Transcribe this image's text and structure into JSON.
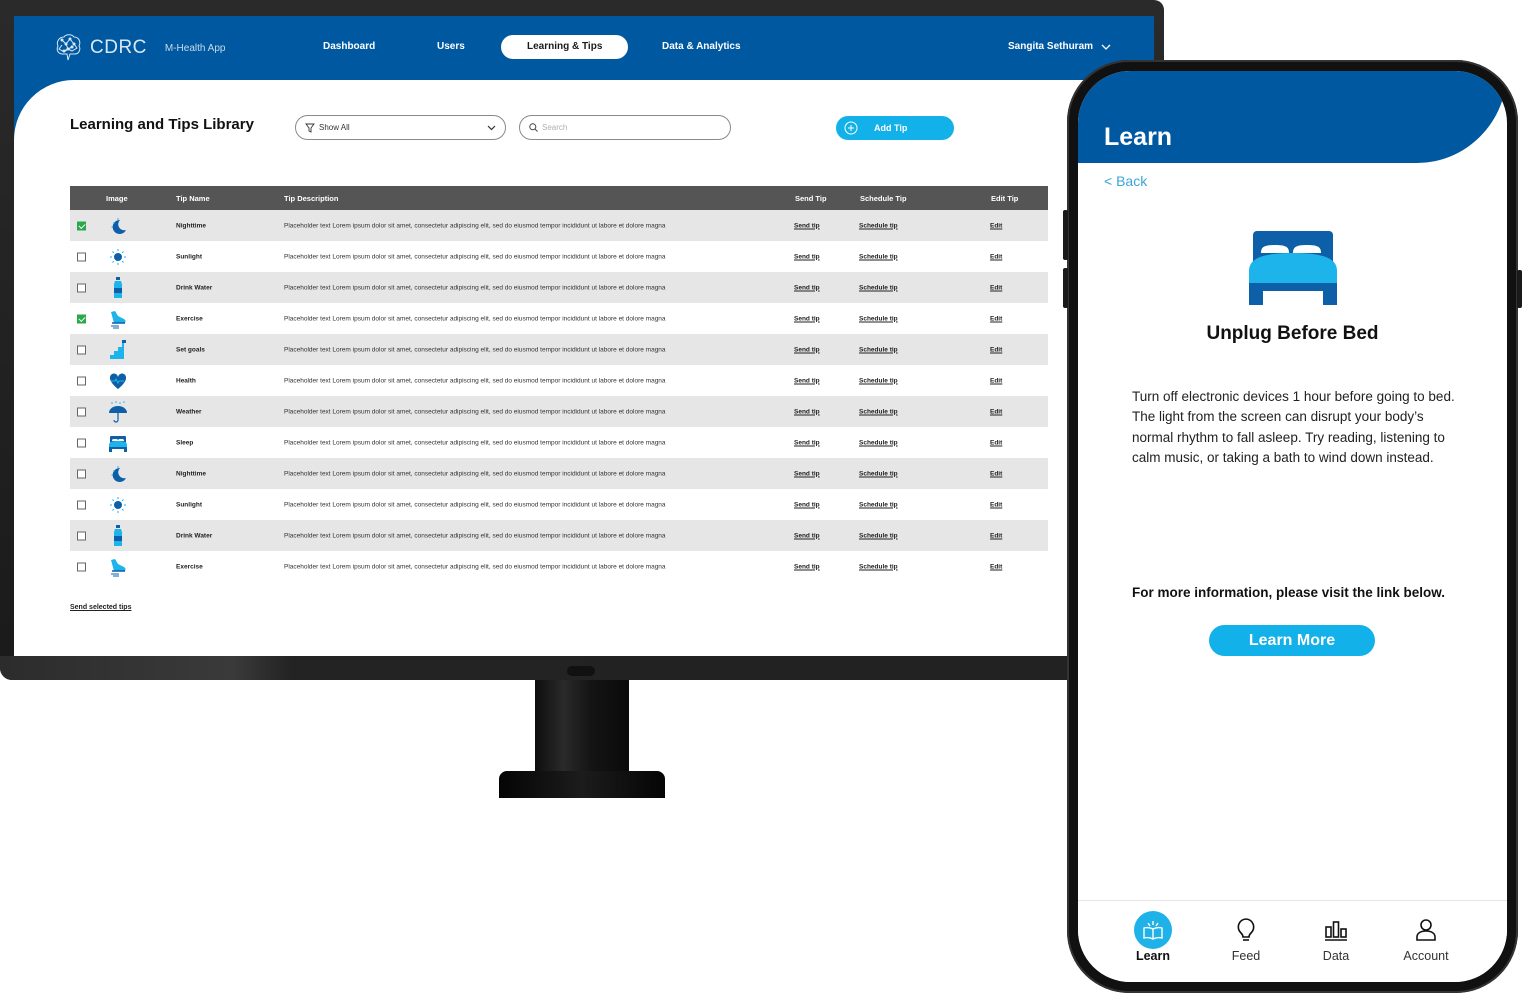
{
  "desktop": {
    "brand": {
      "name": "CDRC",
      "subtitle": "M-Health App",
      "icon": "brain-network-icon"
    },
    "nav": [
      {
        "label": "Dashboard",
        "active": false
      },
      {
        "label": "Users",
        "active": false
      },
      {
        "label": "Learning & Tips",
        "active": true
      },
      {
        "label": "Data & Analytics",
        "active": false
      }
    ],
    "user_menu": {
      "name": "Sangita Sethuram",
      "icon": "chevron-down-icon"
    },
    "page_title": "Learning and Tips Library",
    "filter": {
      "selected": "Show All",
      "icon": "filter-icon"
    },
    "search": {
      "placeholder": "Search",
      "value": ""
    },
    "add_button": {
      "label": "Add Tip",
      "icon": "plus-circle-icon"
    },
    "table": {
      "columns": [
        "",
        "Image",
        "Tip Name",
        "Tip Description",
        "Send Tip",
        "Schedule Tip",
        "Edit Tip"
      ],
      "rows": [
        {
          "checked": true,
          "icon": "moon-icon",
          "name": "Nighttime",
          "description": "Placeholder text  Lorem ipsum dolor sit amet, consectetur adipiscing elit, sed do eiusmod tempor incididunt ut labore et dolore magna",
          "send": "Send tip",
          "schedule": "Schedule tip",
          "edit": "Edit"
        },
        {
          "checked": false,
          "icon": "sun-icon",
          "name": "Sunlight",
          "description": "Placeholder text  Lorem ipsum dolor sit amet, consectetur adipiscing elit, sed do eiusmod tempor incididunt ut labore et dolore magna",
          "send": "Send tip",
          "schedule": "Schedule tip",
          "edit": "Edit"
        },
        {
          "checked": false,
          "icon": "water-bottle-icon",
          "name": "Drink Water",
          "description": "Placeholder text  Lorem ipsum dolor sit amet, consectetur adipiscing elit, sed do eiusmod tempor incididunt ut labore et dolore magna",
          "send": "Send tip",
          "schedule": "Schedule tip",
          "edit": "Edit"
        },
        {
          "checked": true,
          "icon": "sneaker-icon",
          "name": "Exercise",
          "description": "Placeholder text  Lorem ipsum dolor sit amet, consectetur adipiscing elit, sed do eiusmod tempor incididunt ut labore et dolore magna",
          "send": "Send tip",
          "schedule": "Schedule tip",
          "edit": "Edit"
        },
        {
          "checked": false,
          "icon": "stairs-flag-icon",
          "name": "Set goals",
          "description": "Placeholder text  Lorem ipsum dolor sit amet, consectetur adipiscing elit, sed do eiusmod tempor incididunt ut labore et dolore magna",
          "send": "Send tip",
          "schedule": "Schedule tip",
          "edit": "Edit"
        },
        {
          "checked": false,
          "icon": "heart-pulse-icon",
          "name": "Health",
          "description": "Placeholder text  Lorem ipsum dolor sit amet, consectetur adipiscing elit, sed do eiusmod tempor incididunt ut labore et dolore magna",
          "send": "Send tip",
          "schedule": "Schedule tip",
          "edit": "Edit"
        },
        {
          "checked": false,
          "icon": "umbrella-rain-icon",
          "name": "Weather",
          "description": "Placeholder text  Lorem ipsum dolor sit amet, consectetur adipiscing elit, sed do eiusmod tempor incididunt ut labore et dolore magna",
          "send": "Send tip",
          "schedule": "Schedule tip",
          "edit": "Edit"
        },
        {
          "checked": false,
          "icon": "bed-icon",
          "name": "Sleep",
          "description": "Placeholder text  Lorem ipsum dolor sit amet, consectetur adipiscing elit, sed do eiusmod tempor incididunt ut labore et dolore magna",
          "send": "Send tip",
          "schedule": "Schedule tip",
          "edit": "Edit"
        },
        {
          "checked": false,
          "icon": "moon-icon",
          "name": "Nighttime",
          "description": "Placeholder text  Lorem ipsum dolor sit amet, consectetur adipiscing elit, sed do eiusmod tempor incididunt ut labore et dolore magna",
          "send": "Send tip",
          "schedule": "Schedule tip",
          "edit": "Edit"
        },
        {
          "checked": false,
          "icon": "sun-icon",
          "name": "Sunlight",
          "description": "Placeholder text  Lorem ipsum dolor sit amet, consectetur adipiscing elit, sed do eiusmod tempor incididunt ut labore et dolore magna",
          "send": "Send tip",
          "schedule": "Schedule tip",
          "edit": "Edit"
        },
        {
          "checked": false,
          "icon": "water-bottle-icon",
          "name": "Drink Water",
          "description": "Placeholder text  Lorem ipsum dolor sit amet, consectetur adipiscing elit, sed do eiusmod tempor incididunt ut labore et dolore magna",
          "send": "Send tip",
          "schedule": "Schedule tip",
          "edit": "Edit"
        },
        {
          "checked": false,
          "icon": "sneaker-icon",
          "name": "Exercise",
          "description": "Placeholder text  Lorem ipsum dolor sit amet, consectetur adipiscing elit, sed do eiusmod tempor incididunt ut labore et dolore magna",
          "send": "Send tip",
          "schedule": "Schedule tip",
          "edit": "Edit"
        }
      ]
    },
    "send_selected": "Send selected tips"
  },
  "mobile": {
    "header_title": "Learn",
    "back_label": "< Back",
    "tip": {
      "icon": "bed-icon",
      "title": "Unplug Before Bed",
      "body": "Turn off electronic devices 1 hour before going to bed. The light from the screen can disrupt your body’s normal rhythm to fall asleep. Try reading, listening to calm music, or taking a bath to wind down instead.",
      "more_info": "For more information, please visit the link below.",
      "button": "Learn More"
    },
    "tabs": [
      {
        "label": "Learn",
        "icon": "book-learn-icon",
        "active": true
      },
      {
        "label": "Feed",
        "icon": "lightbulb-icon",
        "active": false
      },
      {
        "label": "Data",
        "icon": "bar-chart-icon",
        "active": false
      },
      {
        "label": "Account",
        "icon": "user-icon",
        "active": false
      }
    ]
  },
  "colors": {
    "brand_blue": "#0059a0",
    "accent_cyan": "#12b1ea",
    "check_green": "#2aa84a",
    "table_header": "#555555"
  }
}
